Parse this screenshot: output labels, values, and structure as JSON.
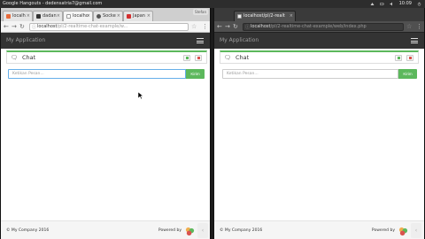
{
  "os": {
    "window_title": "Google Hangouts - dedensatria7@gmail.com",
    "clock": "10:09"
  },
  "left_browser": {
    "tabs": [
      {
        "label": "localh",
        "active": false,
        "color": "#e86b3b"
      },
      {
        "label": "dadan",
        "active": false,
        "color": "#333333"
      },
      {
        "label": "localho",
        "active": true,
        "color": "#9e9e9e"
      },
      {
        "label": "Socke",
        "active": false,
        "color": "#555555"
      },
      {
        "label": "Japan",
        "active": false,
        "color": "#d32f2f"
      }
    ],
    "profile_chip": "Stefan",
    "url_host": "localhost",
    "url_path": "/pl/2-realtime-chat-example/w..."
  },
  "right_browser": {
    "tabs": [
      {
        "label": "localhost/pl/2-realt",
        "active": true,
        "color": "#9e9e9e"
      }
    ],
    "url_host": "localhost",
    "url_path": "/pl/2-realtime-chat-example/web/index.php"
  },
  "app": {
    "brand": "My Application",
    "panel_title": "Chat",
    "input_placeholder": "Ketikan Pesan...",
    "send_label": "Kirim",
    "footer_left": "© My Company 2016",
    "footer_right": "Powered by",
    "scroll_top_icon": "chevron-up-icon",
    "accent_color": "#5cb85c",
    "navbar_color": "#333333"
  }
}
